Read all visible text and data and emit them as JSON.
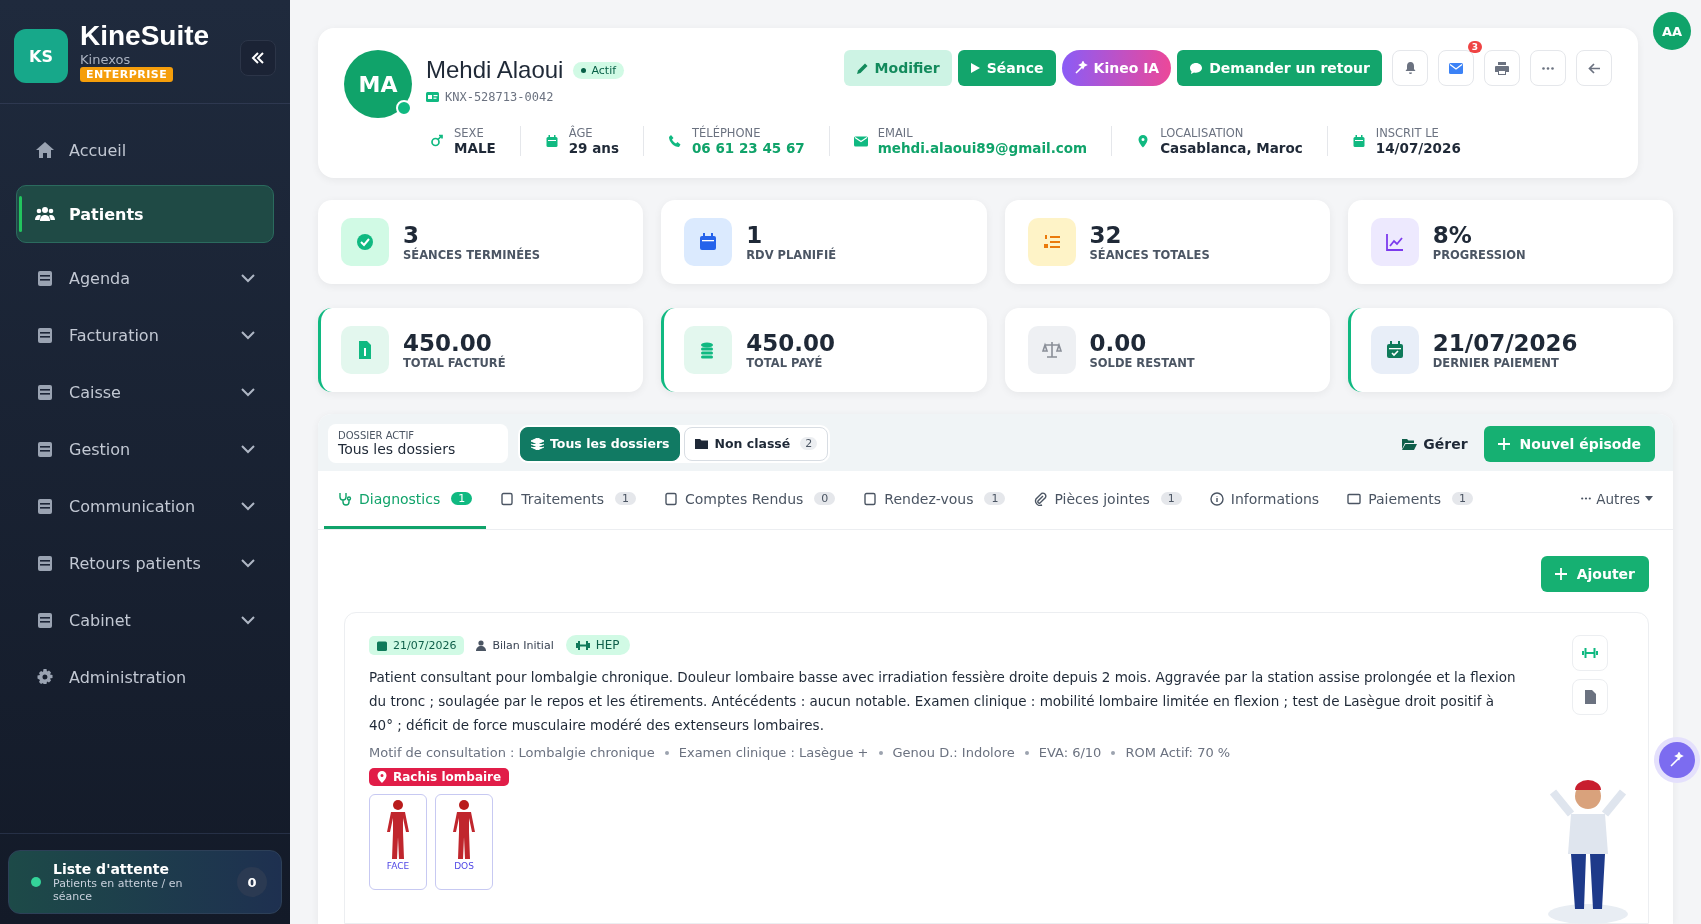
{
  "brand": {
    "logo": "KS",
    "name": "KineSuite",
    "org": "Kinexos",
    "plan": "ENTERPRISE"
  },
  "sidebar": {
    "items": [
      {
        "label": "Accueil",
        "selected": false,
        "expandable": false
      },
      {
        "label": "Patients",
        "selected": true,
        "expandable": false
      },
      {
        "label": "Agenda",
        "selected": false,
        "expandable": true
      },
      {
        "label": "Facturation",
        "selected": false,
        "expandable": true
      },
      {
        "label": "Caisse",
        "selected": false,
        "expandable": true
      },
      {
        "label": "Gestion",
        "selected": false,
        "expandable": true
      },
      {
        "label": "Communication",
        "selected": false,
        "expandable": true
      },
      {
        "label": "Retours patients",
        "selected": false,
        "expandable": true
      },
      {
        "label": "Cabinet",
        "selected": false,
        "expandable": true
      },
      {
        "label": "Administration",
        "selected": false,
        "expandable": false
      }
    ],
    "waiting": {
      "title": "Liste d'attente",
      "subtitle": "Patients en attente / en séance",
      "count": "0"
    }
  },
  "user_avatar": "AA",
  "patient": {
    "initials": "MA",
    "online": true,
    "name": "Mehdi Alaoui",
    "status": "Actif",
    "id": "KNX-528713-0042",
    "fields": [
      {
        "label": "SEXE",
        "value": "MALE",
        "kind": "plain"
      },
      {
        "label": "ÂGE",
        "value": "29 ans",
        "kind": "plain"
      },
      {
        "label": "TÉLÉPHONE",
        "value": "06 61 23 45 67",
        "kind": "link"
      },
      {
        "label": "EMAIL",
        "value": "mehdi.alaoui89@gmail.com",
        "kind": "link"
      },
      {
        "label": "LOCALISATION",
        "value": "Casablanca, Maroc",
        "kind": "plain"
      },
      {
        "label": "INSCRIT LE",
        "value": "14/07/2026",
        "kind": "plain"
      }
    ],
    "actions": [
      {
        "label": "Modifier",
        "kind": "soft"
      },
      {
        "label": "Séance",
        "kind": "solid"
      },
      {
        "label": "Kineo IA",
        "kind": "ai"
      },
      {
        "label": "Demander un retour",
        "kind": "solid"
      }
    ],
    "notification_badge": "3"
  },
  "stats": [
    {
      "value": "3",
      "label": "SÉANCES TERMINÉES",
      "color": "#d1fae5",
      "accent": false
    },
    {
      "value": "1",
      "label": "RDV PLANIFIÉ",
      "color": "#dbeafe",
      "accent": false
    },
    {
      "value": "32",
      "label": "SÉANCES TOTALES",
      "color": "#fef3c7",
      "accent": false
    },
    {
      "value": "8%",
      "label": "PROGRESSION",
      "color": "#ede9fe",
      "accent": false
    },
    {
      "value": "450.00",
      "label": "TOTAL FACTURÉ",
      "color": "#e3f7ee",
      "accent": true
    },
    {
      "value": "450.00",
      "label": "TOTAL PAYÉ",
      "color": "#e3f7ee",
      "accent": true
    },
    {
      "value": "0.00",
      "label": "SOLDE RESTANT",
      "color": "#eef0f3",
      "accent": false
    },
    {
      "value": "21/07/2026",
      "label": "DERNIER PAIEMENT",
      "color": "#e8eef8",
      "accent": true
    }
  ],
  "dossier": {
    "caption": "DOSSIER ACTIF",
    "value": "Tous les dossiers",
    "filters": [
      {
        "label": "Tous les dossiers",
        "selected": true
      },
      {
        "label": "Non classé",
        "count": "2",
        "selected": false
      }
    ],
    "manage": "Gérer",
    "new_episode": "Nouvel épisode"
  },
  "tabs": [
    {
      "label": "Diagnostics",
      "count": "1",
      "selected": true
    },
    {
      "label": "Traitements",
      "count": "1",
      "selected": false
    },
    {
      "label": "Comptes Rendus",
      "count": "0",
      "selected": false
    },
    {
      "label": "Rendez-vous",
      "count": "1",
      "selected": false
    },
    {
      "label": "Pièces jointes",
      "count": "1",
      "selected": false
    },
    {
      "label": "Informations",
      "selected": false
    },
    {
      "label": "Paiements",
      "count": "1",
      "selected": false
    }
  ],
  "more_tab": "Autres",
  "add_button": "Ajouter",
  "diagnostic": {
    "date": "21/07/2026",
    "type": "Bilan Initial",
    "tag": "HEP",
    "text": "Patient consultant pour lombalgie chronique.  Douleur lombaire basse avec irradiation fessière droite depuis 2 mois. Aggravée par la station assise prolongée et la flexion du tronc ; soulagée par le repos et les étirements. Antécédents : aucun notable. Examen clinique : mobilité lombaire limitée en flexion ; test de Lasègue droit positif à 40° ; déficit de force musculaire modéré des extenseurs lombaires.",
    "details": [
      "Motif de consultation : Lombalgie chronique",
      "Examen clinique : Lasègue +",
      "Genou D.: Indolore",
      "EVA: 6/10",
      "ROM Actif: 70 %"
    ],
    "region": "Rachis lombaire",
    "views": [
      "FACE",
      "DOS"
    ]
  }
}
